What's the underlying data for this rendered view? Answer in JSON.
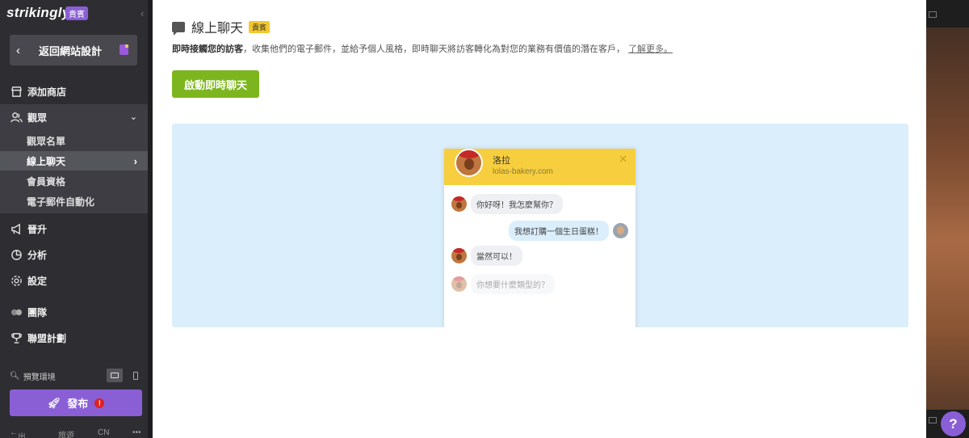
{
  "app": {
    "logo": "strikingly",
    "logo_badge": "貴賓"
  },
  "sidebar": {
    "back_label": "返回網站設計",
    "nav": {
      "store": "添加商店",
      "audience": "觀眾",
      "growth": "晉升",
      "analytics": "分析",
      "settings": "設定",
      "team": "團隊",
      "affiliate": "聯盟計劃"
    },
    "sub_items": [
      "觀眾名單",
      "線上聊天",
      "會員資格",
      "電子郵件自動化"
    ],
    "preview_label": "預覽環境",
    "publish_label": "發布",
    "publish_alert": "!",
    "footer": {
      "logout": "出口",
      "tour": "旅遊",
      "lang": "CN",
      "more": "•••"
    }
  },
  "main": {
    "title": "線上聊天",
    "title_badge": "貴賓",
    "desc_strong": "即時接觸您的訪客",
    "desc_rest": "，收集他們的電子郵件，並給予個人風格，即時聊天將訪客轉化為對您的業務有價值的潛在客戶，",
    "learn_more": "了解更多。",
    "start_button": "啟動即時聊天"
  },
  "chat_demo": {
    "agent_name": "洛拉",
    "agent_site": "lolas-bakery.com",
    "messages": [
      {
        "from": "agent",
        "text": "你好呀！我怎麼幫你？"
      },
      {
        "from": "user",
        "text": "我想訂購一個生日蛋糕！"
      },
      {
        "from": "agent",
        "text": "當然可以！"
      },
      {
        "from": "agent",
        "text": "你想要什麼類型的？"
      }
    ]
  },
  "help_button": "?"
}
